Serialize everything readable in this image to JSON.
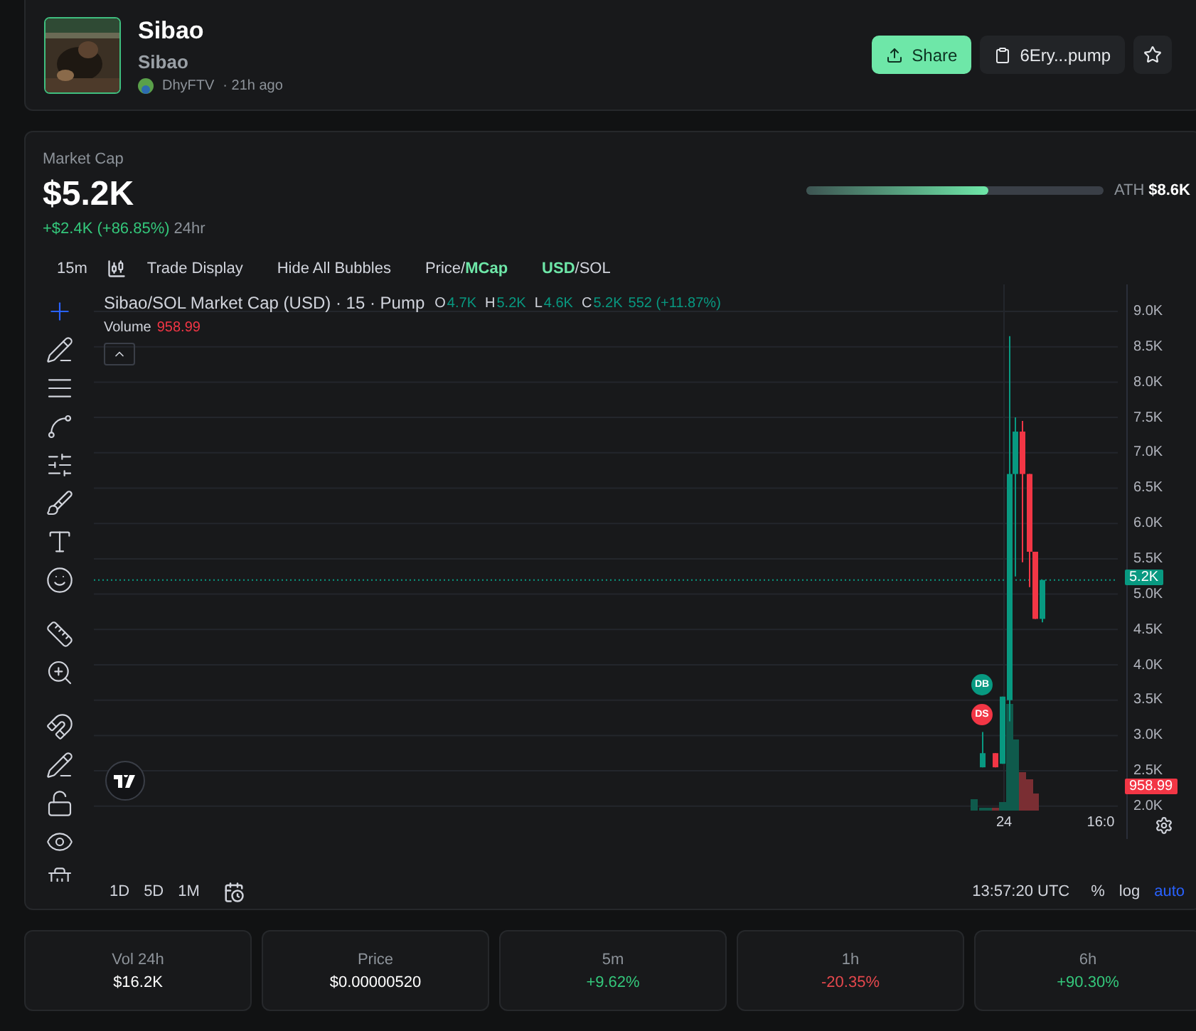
{
  "token": {
    "name": "Sibao",
    "ticker": "Sibao",
    "creator": "DhyFTV",
    "age": "· 21h ago"
  },
  "actions": {
    "share": "Share",
    "address": "6Ery...pump",
    "favorite": false
  },
  "market_cap": {
    "label": "Market Cap",
    "value": "$5.2K",
    "change": "+$2.4K (+86.85%)",
    "period": "24hr",
    "ath_label": "ATH",
    "ath_value": "$8.6K",
    "level": 0.61
  },
  "chart_toolbar": {
    "interval": "15m",
    "trade_display": "Trade Display",
    "hide_bubbles": "Hide All Bubbles",
    "toggle_separator": "/",
    "price_toggle": [
      {
        "label": "Price",
        "selected": false
      },
      {
        "label": "MCap",
        "selected": true
      }
    ],
    "currency_toggle": [
      {
        "label": "USD",
        "selected": true
      },
      {
        "label": "SOL",
        "selected": false
      }
    ]
  },
  "drawing_tools": [
    {
      "selected": true
    },
    {
      "selected": false
    },
    {
      "selected": false
    },
    {
      "selected": false
    },
    {
      "selected": false
    },
    {
      "selected": false
    },
    {
      "selected": false
    },
    {
      "selected": false
    },
    {
      "selected": false
    },
    {
      "selected": false
    },
    {
      "selected": false
    },
    {
      "selected": false
    },
    {
      "selected": false
    },
    {
      "selected": false
    },
    {
      "selected": false
    }
  ],
  "legend": {
    "title": "Sibao/SOL Market Cap (USD) · 15 · Pump",
    "ohlc": [
      {
        "key": "O",
        "value": "4.7K"
      },
      {
        "key": "H",
        "value": "5.2K"
      },
      {
        "key": "L",
        "value": "4.6K"
      },
      {
        "key": "C",
        "value": "5.2K"
      }
    ],
    "change": "552 (+11.87%)",
    "volume_label": "Volume",
    "volume_value": "958.99"
  },
  "markers": [
    {
      "label": "DB",
      "color": "#089981"
    },
    {
      "label": "DS",
      "color": "#f23645"
    }
  ],
  "price_axis": [
    "9.0K",
    "8.5K",
    "8.0K",
    "7.5K",
    "7.0K",
    "6.5K",
    "6.0K",
    "5.5K",
    "5.0K",
    "4.5K",
    "4.0K",
    "3.5K",
    "3.0K",
    "2.5K",
    "2.0K"
  ],
  "price_badge": "5.2K",
  "volume_badge": "958.99",
  "time_axis": [
    "24",
    "16:0"
  ],
  "ranges": [
    "1D",
    "5D",
    "1M"
  ],
  "clock": "13:57:20 UTC",
  "scale_options": [
    {
      "label": "%",
      "selected": false
    },
    {
      "label": "log",
      "selected": false
    },
    {
      "label": "auto",
      "selected": true
    }
  ],
  "stats": [
    {
      "label": "Vol 24h",
      "value": "$16.2K",
      "color": "#ffffff"
    },
    {
      "label": "Price",
      "value": "$0.00000520",
      "color": "#ffffff"
    },
    {
      "label": "5m",
      "value": "+9.62%",
      "color": "#34c77b"
    },
    {
      "label": "1h",
      "value": "-20.35%",
      "color": "#e5484d"
    },
    {
      "label": "6h",
      "value": "+90.30%",
      "color": "#34c77b"
    }
  ]
}
